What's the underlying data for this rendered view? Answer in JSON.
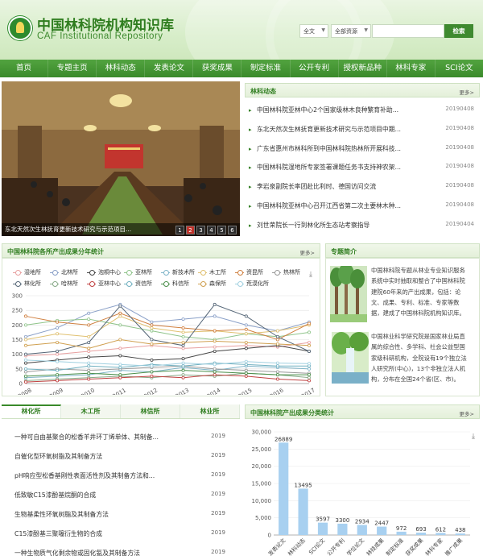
{
  "header": {
    "title": "中国林科院机构知识库",
    "subtitle": "CAF Institutional Repository",
    "search_scope": "全文",
    "search_type": "全部资源",
    "search_button": "检索"
  },
  "nav": [
    "首页",
    "专题主页",
    "林科动态",
    "发表论文",
    "获奖成果",
    "制定标准",
    "公开专利",
    "授权新品种",
    "林科专家",
    "SCI论文"
  ],
  "photo": {
    "caption": "东北天然次生林抚育更新技术研究与示范项目...",
    "pages": [
      "1",
      "2",
      "3",
      "4",
      "5",
      "6"
    ]
  },
  "news": {
    "title": "林科动态",
    "more": "更多>",
    "items": [
      {
        "text": "中国林科院亚林中心2个国家级林木良种繁育补助...",
        "date": "20190408"
      },
      {
        "text": "东北天然次生林抚育更新技术研究与示范项目中期...",
        "date": "20190408"
      },
      {
        "text": "广东省惠州市林科所到中国林科院热林所开展科技...",
        "date": "20190408"
      },
      {
        "text": "中国林科院湿地所专家签署课题任务书支持神农架...",
        "date": "20190408"
      },
      {
        "text": "李岩泉副院长率团赴比利时、德国访问交流",
        "date": "20190408"
      },
      {
        "text": "中国林科院亚林中心召开江西省第二次主要林木种...",
        "date": "20190408"
      },
      {
        "text": "刘世荣院长一行到林化所生态站考察指导",
        "date": "20190404"
      }
    ]
  },
  "trend": {
    "title": "中国林科院各所产出成果分年统计",
    "more": "更多>"
  },
  "chart_data": [
    {
      "type": "line",
      "x": [
        "2008",
        "2009",
        "2010",
        "2011",
        "2012",
        "2013",
        "2014",
        "2015",
        "2016",
        "2017"
      ],
      "ylim": [
        0,
        300
      ],
      "yticks": [
        0,
        50,
        100,
        150,
        200,
        250,
        300
      ],
      "grid": true,
      "legend_position": "top",
      "series": [
        {
          "name": "湿地所",
          "color": "#e8a0a0",
          "values": [
            95,
            100,
            110,
            120,
            130,
            120,
            125,
            130,
            125,
            140
          ]
        },
        {
          "name": "北林所",
          "color": "#8aa0c8",
          "values": [
            160,
            190,
            240,
            270,
            210,
            220,
            230,
            200,
            180,
            210
          ]
        },
        {
          "name": "泡桐中心",
          "color": "#444444",
          "values": [
            70,
            80,
            90,
            95,
            80,
            85,
            110,
            120,
            130,
            110
          ]
        },
        {
          "name": "亚林所",
          "color": "#8fc48a",
          "values": [
            200,
            215,
            220,
            200,
            180,
            160,
            150,
            170,
            160,
            175
          ]
        },
        {
          "name": "新技术所",
          "color": "#7fb5c9",
          "values": [
            20,
            25,
            30,
            45,
            40,
            55,
            45,
            60,
            55,
            50
          ]
        },
        {
          "name": "木工所",
          "color": "#e0c070",
          "values": [
            150,
            170,
            160,
            230,
            190,
            175,
            180,
            170,
            180,
            200
          ]
        },
        {
          "name": "资昆所",
          "color": "#d08040",
          "values": [
            230,
            210,
            200,
            240,
            200,
            190,
            180,
            185,
            150,
            205
          ]
        },
        {
          "name": "热林所",
          "color": "#999999",
          "values": [
            40,
            50,
            45,
            50,
            55,
            60,
            50,
            45,
            40,
            35
          ]
        },
        {
          "name": "林化所",
          "color": "#556677",
          "values": [
            100,
            110,
            140,
            265,
            150,
            130,
            270,
            230,
            160,
            110
          ]
        },
        {
          "name": "哈林所",
          "color": "#88aa88",
          "values": [
            10,
            15,
            20,
            25,
            20,
            30,
            25,
            35,
            30,
            20
          ]
        },
        {
          "name": "亚林中心",
          "color": "#c04040",
          "values": [
            5,
            10,
            15,
            20,
            25,
            20,
            30,
            25,
            15,
            10
          ]
        },
        {
          "name": "资信所",
          "color": "#70b0c0",
          "values": [
            50,
            45,
            60,
            55,
            65,
            60,
            70,
            65,
            60,
            60
          ]
        },
        {
          "name": "科信所",
          "color": "#4a8f4a",
          "values": [
            25,
            30,
            35,
            30,
            40,
            45,
            40,
            35,
            30,
            30
          ]
        },
        {
          "name": "森保所",
          "color": "#d0a050",
          "values": [
            130,
            140,
            120,
            150,
            135,
            140,
            145,
            140,
            135,
            130
          ]
        },
        {
          "name": "荒漠化所",
          "color": "#a0d0e0",
          "values": [
            80,
            75,
            70,
            65,
            60,
            70,
            65,
            75,
            70,
            68
          ]
        }
      ]
    },
    {
      "type": "bar",
      "categories": [
        "发表论文",
        "林科动态",
        "SCI论文",
        "公开专利",
        "学位论文",
        "林技成果",
        "制定标准",
        "获奖成果",
        "林科专家",
        "推广成果"
      ],
      "values": [
        26889,
        13495,
        3597,
        3300,
        2934,
        2447,
        972,
        693,
        612,
        438
      ],
      "ylim": [
        0,
        30000
      ],
      "yticks": [
        0,
        5000,
        10000,
        15000,
        20000,
        25000,
        30000
      ],
      "color": "#a8d0f0"
    }
  ],
  "intro": {
    "title": "专题简介",
    "para1": [
      "中国林科院专题从林业专业知识服务",
      "系统中实时抽取和整合了中国林科院",
      "建院60年来的产出成果，包括：论",
      "文、成果、专利、标准、专家等数",
      "据，建成了中国林科院机构知识库。"
    ],
    "para2": [
      "中国林业科学研究院是国家林业局直",
      "属的综合性、多学科、社会公益型国",
      "家级科研机构，全院设有19个独立法",
      "人研究所(中心)，13个非独立法人机",
      "构，分布在全国24个省(区、市)。"
    ]
  },
  "tabs": [
    "林化所",
    "木工所",
    "林信所",
    "林业所"
  ],
  "papers": [
    {
      "text": "一种可自由基聚合的松香羊井环丁烯单体、其制备...",
      "year": "2019"
    },
    {
      "text": "自催化型环氧树脂及其制备方法",
      "year": "2019"
    },
    {
      "text": "pH响应型松香基刚性表面活性剂及其制备方法和...",
      "year": "2019"
    },
    {
      "text": "低致敏C15漆酚基烷酮的合成",
      "year": "2019"
    },
    {
      "text": "生物基柔性环氧树脂及其制备方法",
      "year": "2019"
    },
    {
      "text": "C15漆酚基三聚噻衍生物的合成",
      "year": "2019"
    },
    {
      "text": "一种生物质气化剩余物或固化氨及其制备方法",
      "year": "2019"
    }
  ],
  "bar_panel": {
    "title": "中国林科院产出成果分类统计",
    "more": "更多>"
  }
}
